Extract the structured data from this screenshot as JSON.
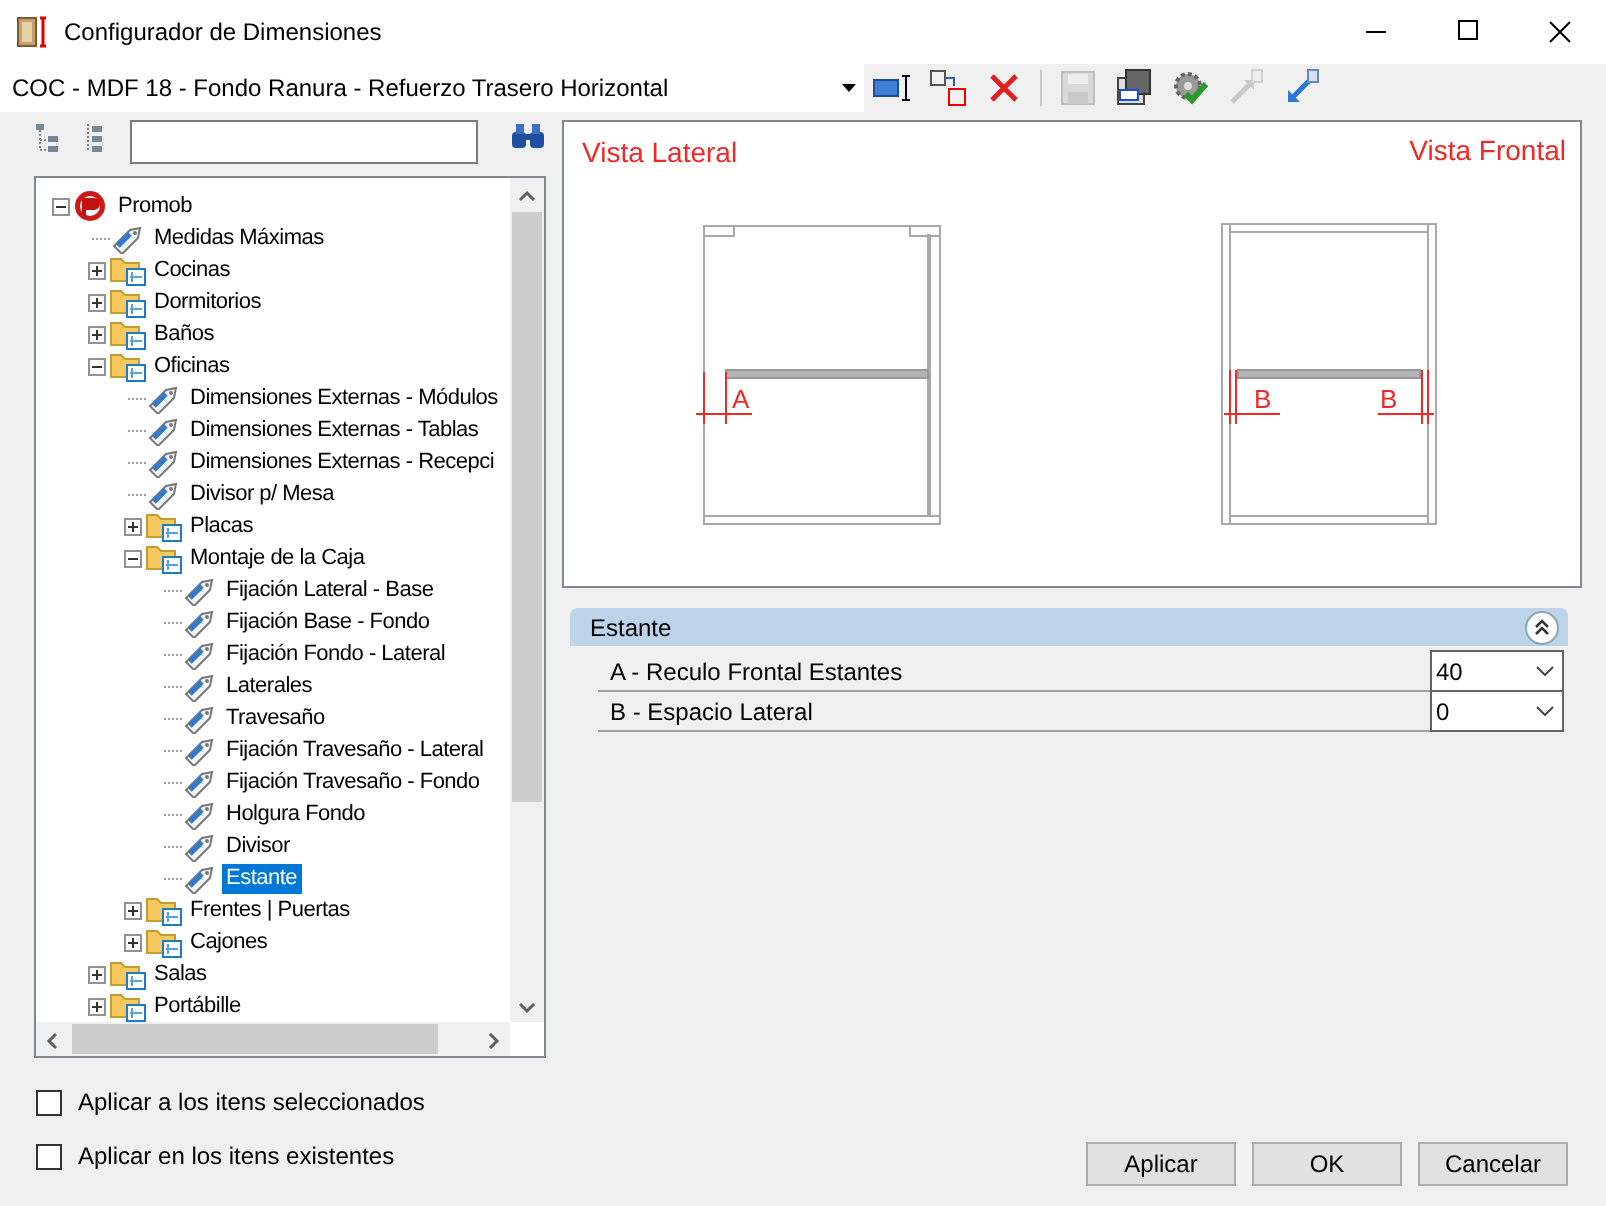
{
  "window": {
    "title": "Configurador de Dimensiones"
  },
  "config_combo": {
    "value": "COC - MDF 18 - Fondo Ranura - Refuerzo Trasero Horizontal"
  },
  "toolbar": [
    {
      "kind": "field",
      "disabled": false
    },
    {
      "kind": "resize",
      "disabled": false
    },
    {
      "kind": "delete",
      "disabled": false
    },
    {
      "kind": "save",
      "disabled": true
    },
    {
      "kind": "saveas",
      "disabled": false
    },
    {
      "kind": "check",
      "disabled": false
    },
    {
      "kind": "export",
      "disabled": true
    },
    {
      "kind": "import",
      "disabled": false
    }
  ],
  "tree": [
    {
      "label": "Promob",
      "kind": "root",
      "expanded": true,
      "selected": false,
      "children": [
        {
          "label": "Medidas Máximas",
          "kind": "leaf",
          "selected": false
        },
        {
          "label": "Cocinas",
          "kind": "folder",
          "expanded": false,
          "selected": false
        },
        {
          "label": "Dormitorios",
          "kind": "folder",
          "expanded": false,
          "selected": false
        },
        {
          "label": "Baños",
          "kind": "folder",
          "expanded": false,
          "selected": false
        },
        {
          "label": "Oficinas",
          "kind": "folder",
          "expanded": true,
          "selected": false,
          "children": [
            {
              "label": "Dimensiones Externas - Módulos",
              "kind": "leaf",
              "selected": false
            },
            {
              "label": "Dimensiones Externas - Tablas",
              "kind": "leaf",
              "selected": false
            },
            {
              "label": "Dimensiones Externas - Recepci",
              "kind": "leaf",
              "selected": false
            },
            {
              "label": "Divisor p/ Mesa",
              "kind": "leaf",
              "selected": false
            },
            {
              "label": "Placas",
              "kind": "folder",
              "expanded": false,
              "selected": false
            },
            {
              "label": "Montaje de la Caja",
              "kind": "folder",
              "expanded": true,
              "selected": false,
              "children": [
                {
                  "label": "Fijación Lateral - Base",
                  "kind": "leaf",
                  "selected": false
                },
                {
                  "label": "Fijación Base - Fondo",
                  "kind": "leaf",
                  "selected": false
                },
                {
                  "label": "Fijación Fondo - Lateral",
                  "kind": "leaf",
                  "selected": false
                },
                {
                  "label": "Laterales",
                  "kind": "leaf",
                  "selected": false
                },
                {
                  "label": "Travesaño",
                  "kind": "leaf",
                  "selected": false
                },
                {
                  "label": "Fijación Travesaño - Lateral",
                  "kind": "leaf",
                  "selected": false
                },
                {
                  "label": "Fijación Travesaño - Fondo",
                  "kind": "leaf",
                  "selected": false
                },
                {
                  "label": "Holgura Fondo",
                  "kind": "leaf",
                  "selected": false
                },
                {
                  "label": "Divisor",
                  "kind": "leaf",
                  "selected": false
                },
                {
                  "label": "Estante",
                  "kind": "leaf",
                  "selected": true
                }
              ]
            },
            {
              "label": "Frentes | Puertas",
              "kind": "folder",
              "expanded": false,
              "selected": false
            },
            {
              "label": "Cajones",
              "kind": "folder",
              "expanded": false,
              "selected": false
            }
          ]
        },
        {
          "label": "Salas",
          "kind": "folder",
          "expanded": false,
          "selected": false
        },
        {
          "label": "Portábille",
          "kind": "folder",
          "expanded": false,
          "selected": false
        }
      ]
    }
  ],
  "preview": {
    "left_title": "Vista Lateral",
    "right_title": "Vista Frontal",
    "lateral_label": "A",
    "frontal_labels": [
      "B",
      "B"
    ]
  },
  "properties": {
    "category": "Estante",
    "expanded": true,
    "rows": [
      {
        "label": "A - Reculo Frontal Estantes",
        "value": "40"
      },
      {
        "label": "B - Espacio Lateral",
        "value": "0"
      }
    ]
  },
  "options": [
    {
      "label": "Aplicar a los itens seleccionados",
      "checked": false
    },
    {
      "label": "Aplicar en los itens existentes",
      "checked": false
    }
  ],
  "buttons": [
    "Aplicar",
    "OK",
    "Cancelar"
  ]
}
